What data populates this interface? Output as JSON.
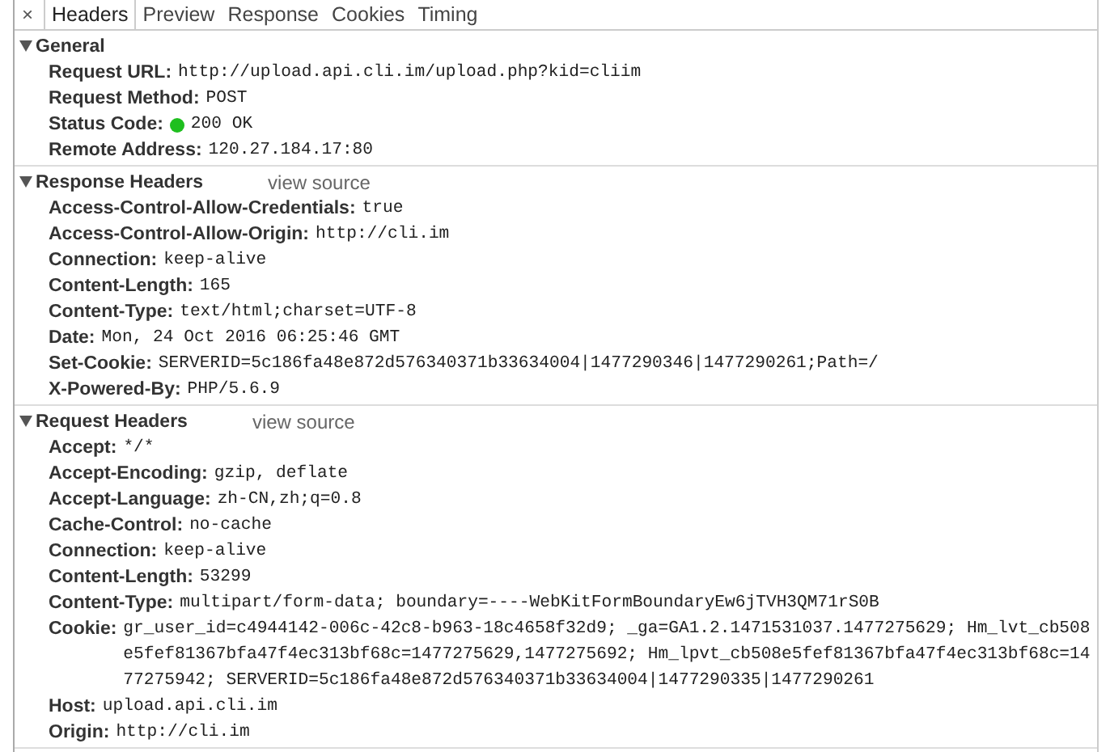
{
  "close_glyph": "×",
  "tabs": [
    {
      "label": "Headers",
      "selected": true
    },
    {
      "label": "Preview",
      "selected": false
    },
    {
      "label": "Response",
      "selected": false
    },
    {
      "label": "Cookies",
      "selected": false
    },
    {
      "label": "Timing",
      "selected": false
    }
  ],
  "sections": [
    {
      "title": "General",
      "expanded": true,
      "rows": [
        {
          "name": "Request URL:",
          "value": "http://upload.api.cli.im/upload.php?kid=cliim"
        },
        {
          "name": "Request Method:",
          "value": "POST"
        },
        {
          "name": "Status Code:",
          "value": "200 OK",
          "color": "#1fbf1f"
        },
        {
          "name": "Remote Address:",
          "value": "120.27.184.17:80"
        }
      ]
    },
    {
      "title": "Response Headers",
      "expanded": true,
      "action": "view source",
      "rows": [
        {
          "name": "Access-Control-Allow-Credentials:",
          "value": "true"
        },
        {
          "name": "Access-Control-Allow-Origin:",
          "value": "http://cli.im"
        },
        {
          "name": "Connection:",
          "value": "keep-alive"
        },
        {
          "name": "Content-Length:",
          "value": "165"
        },
        {
          "name": "Content-Type:",
          "value": "text/html;charset=UTF-8"
        },
        {
          "name": "Date:",
          "value": "Mon, 24 Oct 2016 06:25:46 GMT"
        },
        {
          "name": "Set-Cookie:",
          "value": "SERVERID=5c186fa48e872d576340371b33634004|1477290346|1477290261;Path=/"
        },
        {
          "name": "X-Powered-By:",
          "value": "PHP/5.6.9"
        }
      ]
    },
    {
      "title": "Request Headers",
      "expanded": true,
      "action": "view source",
      "rows": [
        {
          "name": "Accept:",
          "value": "*/*"
        },
        {
          "name": "Accept-Encoding:",
          "value": "gzip, deflate"
        },
        {
          "name": "Accept-Language:",
          "value": "zh-CN,zh;q=0.8"
        },
        {
          "name": "Cache-Control:",
          "value": "no-cache"
        },
        {
          "name": "Connection:",
          "value": "keep-alive"
        },
        {
          "name": "Content-Length:",
          "value": "53299"
        },
        {
          "name": "Content-Type:",
          "value": "multipart/form-data; boundary=----WebKitFormBoundaryEw6jTVH3QM71rS0B"
        },
        {
          "name": "Cookie:",
          "value": "gr_user_id=c4944142-006c-42c8-b963-18c4658f32d9; _ga=GA1.2.1471531037.1477275629; Hm_lvt_cb508e5fef81367bfa47f4ec313bf68c=1477275629,1477275692; Hm_lpvt_cb508e5fef81367bfa47f4ec313bf68c=1477275942; SERVERID=5c186fa48e872d576340371b33634004|1477290335|1477290261"
        },
        {
          "name": "Host:",
          "value": "upload.api.cli.im"
        },
        {
          "name": "Origin:",
          "value": "http://cli.im"
        }
      ]
    }
  ]
}
